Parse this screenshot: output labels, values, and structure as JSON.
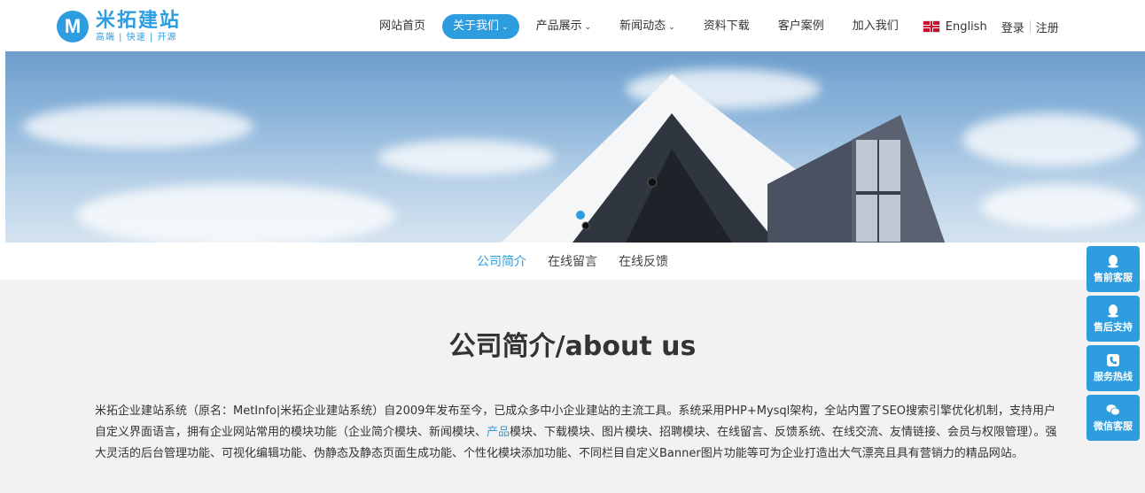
{
  "logo": {
    "mark": "M",
    "name": "米拓建站",
    "tagline": "高端 | 快速 | 开源"
  },
  "nav": {
    "items": [
      {
        "label": "网站首页",
        "active": false,
        "dropdown": false
      },
      {
        "label": "关于我们",
        "active": true,
        "dropdown": true
      },
      {
        "label": "产品展示",
        "active": false,
        "dropdown": true
      },
      {
        "label": "新闻动态",
        "active": false,
        "dropdown": true
      },
      {
        "label": "资料下载",
        "active": false,
        "dropdown": false
      },
      {
        "label": "客户案例",
        "active": false,
        "dropdown": false
      },
      {
        "label": "加入我们",
        "active": false,
        "dropdown": false
      }
    ],
    "language": "English",
    "login": "登录",
    "register": "注册"
  },
  "subnav": {
    "items": [
      "公司简介",
      "在线留言",
      "在线反馈"
    ],
    "active_index": 0
  },
  "page": {
    "title": "公司简介/about us",
    "desc_before": "米拓企业建站系统（原名：MetInfo|米拓企业建站系统）自2009年发布至今，已成众多中小企业建站的主流工具。系统采用PHP+Mysql架构，全站内置了SEO搜索引擎优化机制，支持用户自定义界面语言，拥有企业网站常用的模块功能（企业简介模块、新闻模块、",
    "desc_link": "产品",
    "desc_after": "模块、下载模块、图片模块、招聘模块、在线留言、反馈系统、在线交流、友情链接、会员与权限管理）。强大灵活的后台管理功能、可视化编辑功能、伪静态及静态页面生成功能、个性化模块添加功能、不同栏目自定义Banner图片功能等可为企业打造出大气漂亮且具有营销力的精品网站。"
  },
  "side_service": [
    {
      "label": "售前客服",
      "icon": "qq-icon"
    },
    {
      "label": "售后支持",
      "icon": "qq-icon"
    },
    {
      "label": "服务热线",
      "icon": "phone-icon"
    },
    {
      "label": "微信客服",
      "icon": "wechat-icon"
    }
  ],
  "colors": {
    "accent": "#2d9de0",
    "content_bg": "#f2f2f2"
  }
}
